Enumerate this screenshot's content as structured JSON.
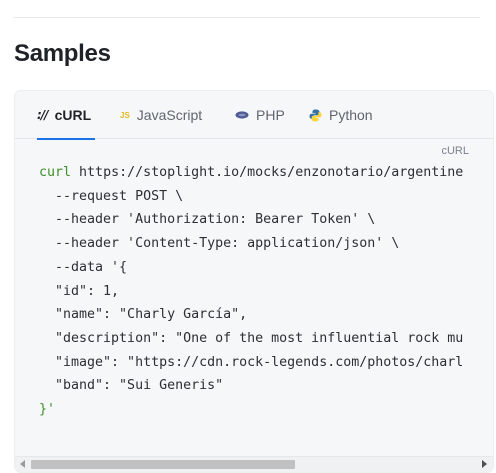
{
  "section": {
    "title": "Samples"
  },
  "tabs": [
    {
      "label": "cURL",
      "icon": "curl-icon",
      "icon_text": "://",
      "active": true
    },
    {
      "label": "JavaScript",
      "icon": "js-icon",
      "icon_text": "JS",
      "active": false
    },
    {
      "label": "PHP",
      "icon": "php-icon",
      "active": false
    },
    {
      "label": "Python",
      "icon": "python-icon",
      "active": false
    }
  ],
  "code": {
    "language_label": "cURL",
    "command": "curl",
    "url": "https://stoplight.io/mocks/enzonotario/argentine",
    "lines": [
      "  --request POST \\",
      "  --header 'Authorization: Bearer Token' \\",
      "  --header 'Content-Type: application/json' \\",
      "  --data '{",
      "  \"id\": 1,",
      "  \"name\": \"Charly García\",",
      "  \"description\": \"One of the most influential rock mu",
      "  \"image\": \"https://cdn.rock-legends.com/photos/charl",
      "  \"band\": \"Sui Generis\""
    ],
    "closing": "}'"
  },
  "colors": {
    "accent": "#1a73e8",
    "keyword": "#3d8f2a",
    "js_icon": "#e3b81d",
    "php_icon": "#4f5b93",
    "python_blue": "#3572a5",
    "python_yellow": "#ffd43b"
  }
}
